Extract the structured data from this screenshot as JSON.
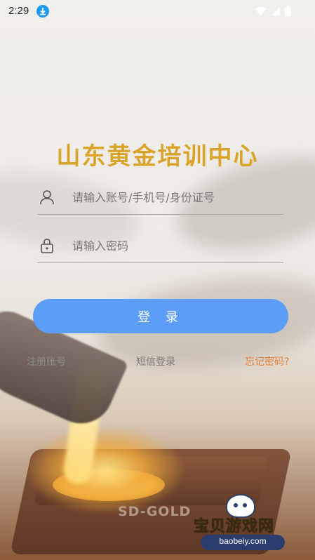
{
  "status_bar": {
    "time": "2:29",
    "icons": [
      "download-icon",
      "wifi-icon",
      "signal-icon",
      "battery-icon"
    ]
  },
  "app": {
    "title": "山东黄金培训中心"
  },
  "form": {
    "account_placeholder": "请输入账号/手机号/身份证号",
    "password_placeholder": "请输入密码",
    "login_label": "登 录"
  },
  "links": {
    "register": "注册账号",
    "sms_login": "短信登录",
    "forgot_password": "忘记密码?"
  },
  "background": {
    "engraved_text": "SD-GOLD"
  },
  "watermark": {
    "name": "宝贝游戏网",
    "url": "baobeiy.com"
  },
  "colors": {
    "title": "#d9a42a",
    "button": "#5b9df7",
    "forgot_link": "#e2823a"
  }
}
